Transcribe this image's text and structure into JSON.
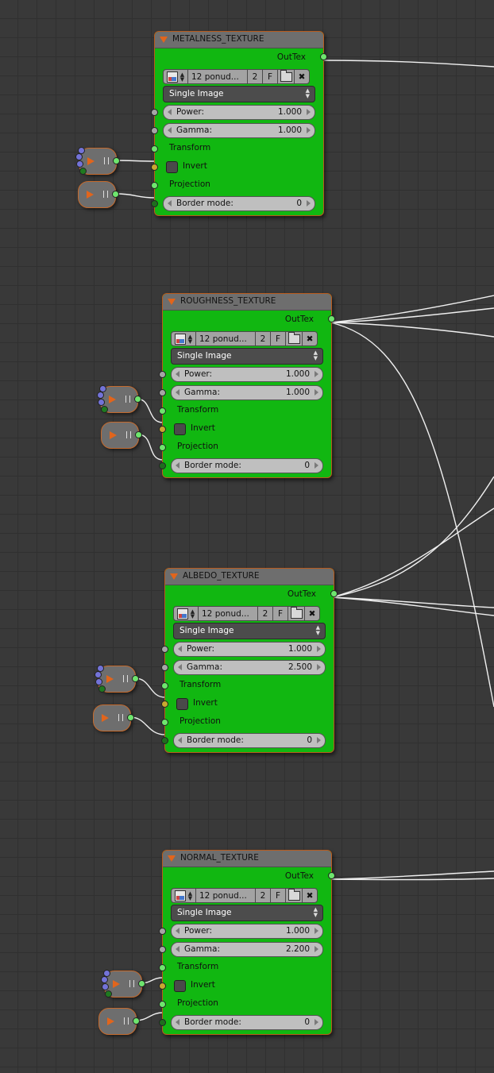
{
  "common": {
    "out_label": "OutTex",
    "image_name": "12 ponud...",
    "image_users": "2",
    "fake_user": "F",
    "source": "Single Image",
    "power_label": "Power:",
    "gamma_label": "Gamma:",
    "transform_label": "Transform",
    "invert_label": "Invert",
    "projection_label": "Projection",
    "border_label": "Border mode:"
  },
  "nodes": [
    {
      "title": "METALNESS_TEXTURE",
      "power": "1.000",
      "gamma": "1.000",
      "border": "0"
    },
    {
      "title": "ROUGHNESS_TEXTURE",
      "power": "1.000",
      "gamma": "1.000",
      "border": "0"
    },
    {
      "title": "ALBEDO_TEXTURE",
      "power": "1.000",
      "gamma": "2.500",
      "border": "0"
    },
    {
      "title": "NORMAL_TEXTURE",
      "power": "1.000",
      "gamma": "2.200",
      "border": "0"
    }
  ],
  "colors": {
    "background": "#393939",
    "grid": "#303030",
    "node_body": "#11b711",
    "node_header": "#6e6e6e",
    "node_border": "#b85a1c",
    "accent_orange": "#e1651c",
    "socket_green": "#6ee56e",
    "socket_yellow": "#c8a830",
    "socket_gray": "#a6a6a6",
    "socket_blue": "#7373d8",
    "wire": "#f0f0f0"
  },
  "icons": {
    "collapse": "triangle-down-icon",
    "image_type": "image-icon",
    "open": "folder-icon",
    "close": "close-icon",
    "play": "play-icon",
    "pause": "pause-icon"
  }
}
